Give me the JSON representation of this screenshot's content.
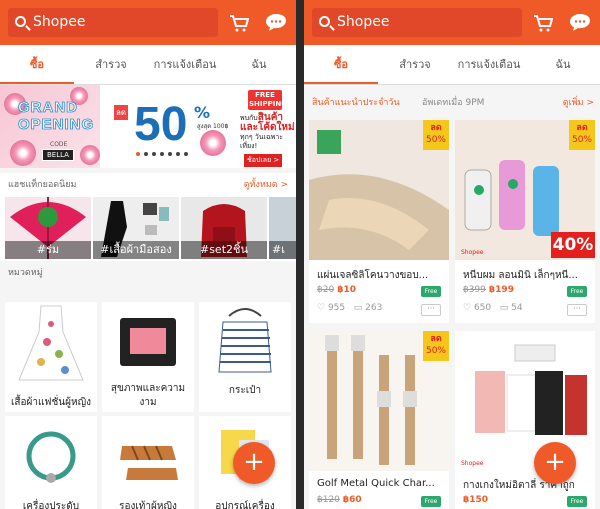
{
  "app": {
    "search_placeholder": "Shopee",
    "accent": "#f05a29"
  },
  "tabs": [
    "ซื้อ",
    "สำรวจ",
    "การแจ้งเตือน",
    "ฉัน"
  ],
  "banner": {
    "grand": "GRAND",
    "opening": "OPENING",
    "sale_tag": "ลด",
    "discount": "50%",
    "upto": "สูงสุด 100฿",
    "code": "CODE",
    "brand": "BELLA",
    "free_shipping": "FREE SHIPPING!",
    "line1": "พบกับ",
    "line2": "สินค้า",
    "line3": "และโค้ดใหม่",
    "line4": "ทุกๆ วันเฉพาะเที่ยง!",
    "shop_now": "ช้อปเลย >"
  },
  "trending": {
    "title": "แฮชแท็กยอดนิยม",
    "see_all": "ดูทั้งหมด >",
    "items": [
      "#ร่ม",
      "#เสื้อผ้ามือสอง",
      "#set2ชิ้น",
      "#เ"
    ]
  },
  "categories": {
    "title": "หมวดหมู่",
    "items": [
      "เสื้อผ้าแฟชั่นผู้หญิง",
      "สุขภาพและความงาม",
      "กระเป๋า",
      "เครื่องประดับ",
      "รองเท้าผู้หญิง",
      "อุปกรณ์เครื่อง"
    ]
  },
  "recommend": {
    "title": "สินค้าแนะนำประจำวัน",
    "updated": "อัพเดทเมื่อ 9PM",
    "more": "ดูเพิ่ม >"
  },
  "products": [
    {
      "title": "แผ่นเจลซิลิโคนวางขอบ...",
      "old": "฿20",
      "price": "฿10",
      "likes": "955",
      "comments": "263",
      "badge_top": "ลด",
      "badge_pct": "50%",
      "free": "Free"
    },
    {
      "title": "หนีบผม ลอนมินิ เล็กๆหนี...",
      "old": "฿399",
      "price": "฿199",
      "likes": "650",
      "comments": "54",
      "badge_top": "ลด",
      "badge_pct": "50%",
      "free": "Free",
      "sticker": "40%",
      "sticker_sub": "ลด",
      "shop": "Shopee"
    },
    {
      "title": "Golf Metal Quick Char...",
      "old": "฿120",
      "price": "฿60",
      "badge_top": "ลด",
      "badge_pct": "50%",
      "free": "Free"
    },
    {
      "title": "กางเกงใหม่อิตาลี่ ราคาถูก",
      "old": "",
      "price": "฿150",
      "free": "Free",
      "shop": "Shopee",
      "sticker": "%"
    }
  ],
  "fab": "+",
  "dots": "···"
}
